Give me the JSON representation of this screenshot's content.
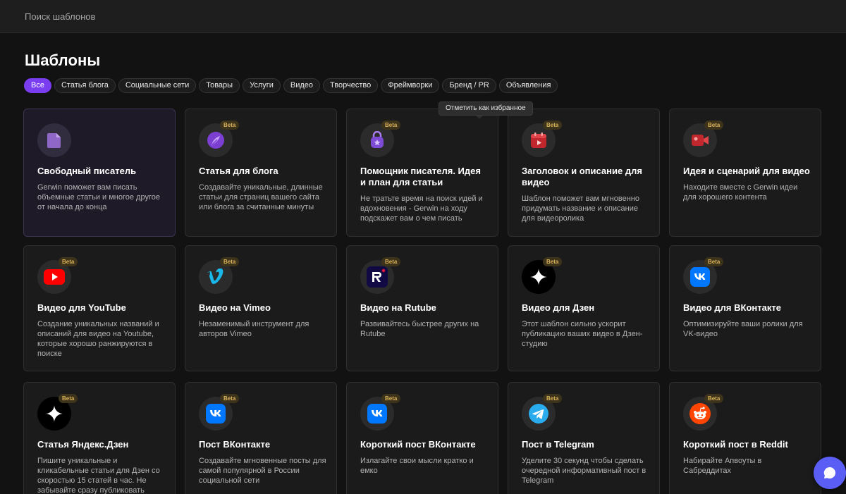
{
  "search": {
    "placeholder": "Поиск шаблонов"
  },
  "page": {
    "title": "Шаблоны"
  },
  "filters": [
    {
      "label": "Все",
      "active": true
    },
    {
      "label": "Статья блога"
    },
    {
      "label": "Социальные сети"
    },
    {
      "label": "Товары"
    },
    {
      "label": "Услуги"
    },
    {
      "label": "Видео"
    },
    {
      "label": "Творчество"
    },
    {
      "label": "Фреймворки"
    },
    {
      "label": "Бренд / PR"
    },
    {
      "label": "Объявления"
    }
  ],
  "tooltip": {
    "text": "Отметить как избранное"
  },
  "badge": {
    "beta": "Beta"
  },
  "cards": [
    {
      "title": "Свободный писатель",
      "description": "Gerwin поможет вам писать объемные статьи и многое другое от начала до конца",
      "icon": "document-icon",
      "beta": false,
      "active": true
    },
    {
      "title": "Статья для блога",
      "description": "Создавайте уникальные, длинные статьи для страниц вашего сайта или блога за считанные минуты",
      "icon": "quill-icon",
      "beta": true
    },
    {
      "title": "Помощник писателя. Идея и план для статьи",
      "description": "Не тратьте время на поиск идей и вдохновения - Gerwin на ходу подскажет вам о чем писать",
      "icon": "idea-bag-icon",
      "beta": true
    },
    {
      "title": "Заголовок и описание для видео",
      "description": "Шаблон поможет вам мгновенно придумать название и описание для видеоролика",
      "icon": "video-calendar-icon",
      "beta": true
    },
    {
      "title": "Идея и сценарий для видео",
      "description": "Находите вместе с Gerwin идеи для хорошего контента",
      "icon": "video-camera-icon",
      "beta": true
    },
    {
      "title": "Видео для YouTube",
      "description": "Создание уникальных названий и описаний для видео на Youtube, которые хорошо ранжируются в поиске",
      "icon": "youtube-icon",
      "beta": true
    },
    {
      "title": "Видео на Vimeo",
      "description": "Незаменимый инструмент для авторов Vimeo",
      "icon": "vimeo-icon",
      "beta": true
    },
    {
      "title": "Видео на Rutube",
      "description": "Развивайтесь быстрее других на Rutube",
      "icon": "rutube-icon",
      "beta": true
    },
    {
      "title": "Видео для Дзен",
      "description": "Этот шаблон сильно ускорит публикацию ваших видео в Дзен-студию",
      "icon": "dzen-icon",
      "beta": true
    },
    {
      "title": "Видео для ВКонтакте",
      "description": "Оптимизируйте ваши ролики для VK-видео",
      "icon": "vk-icon",
      "beta": true
    },
    {
      "title": "Статья Яндекс.Дзен",
      "description": "Пишите уникальные и кликабельные статьи для Дзен со скоростью 15 статей в час. Не забывайте сразу публиковать первый комментарий",
      "icon": "dzen-icon",
      "beta": true
    },
    {
      "title": "Пост ВКонтакте",
      "description": "Создавайте мгновенные посты для самой популярной в России социальной сети",
      "icon": "vk-icon",
      "beta": true
    },
    {
      "title": "Короткий пост ВКонтакте",
      "description": "Излагайте свои мысли кратко и емко",
      "icon": "vk-icon",
      "beta": true
    },
    {
      "title": "Пост в Telegram",
      "description": "Уделите 30 секунд чтобы сделать очередной информативный пост в Telegram",
      "icon": "telegram-icon",
      "beta": true
    },
    {
      "title": "Короткий пост в Reddit",
      "description": "Набирайте Апвоуты в Сабреддитах",
      "icon": "reddit-icon",
      "beta": true
    }
  ],
  "chat": {
    "icon": "chat-bubble-icon"
  }
}
